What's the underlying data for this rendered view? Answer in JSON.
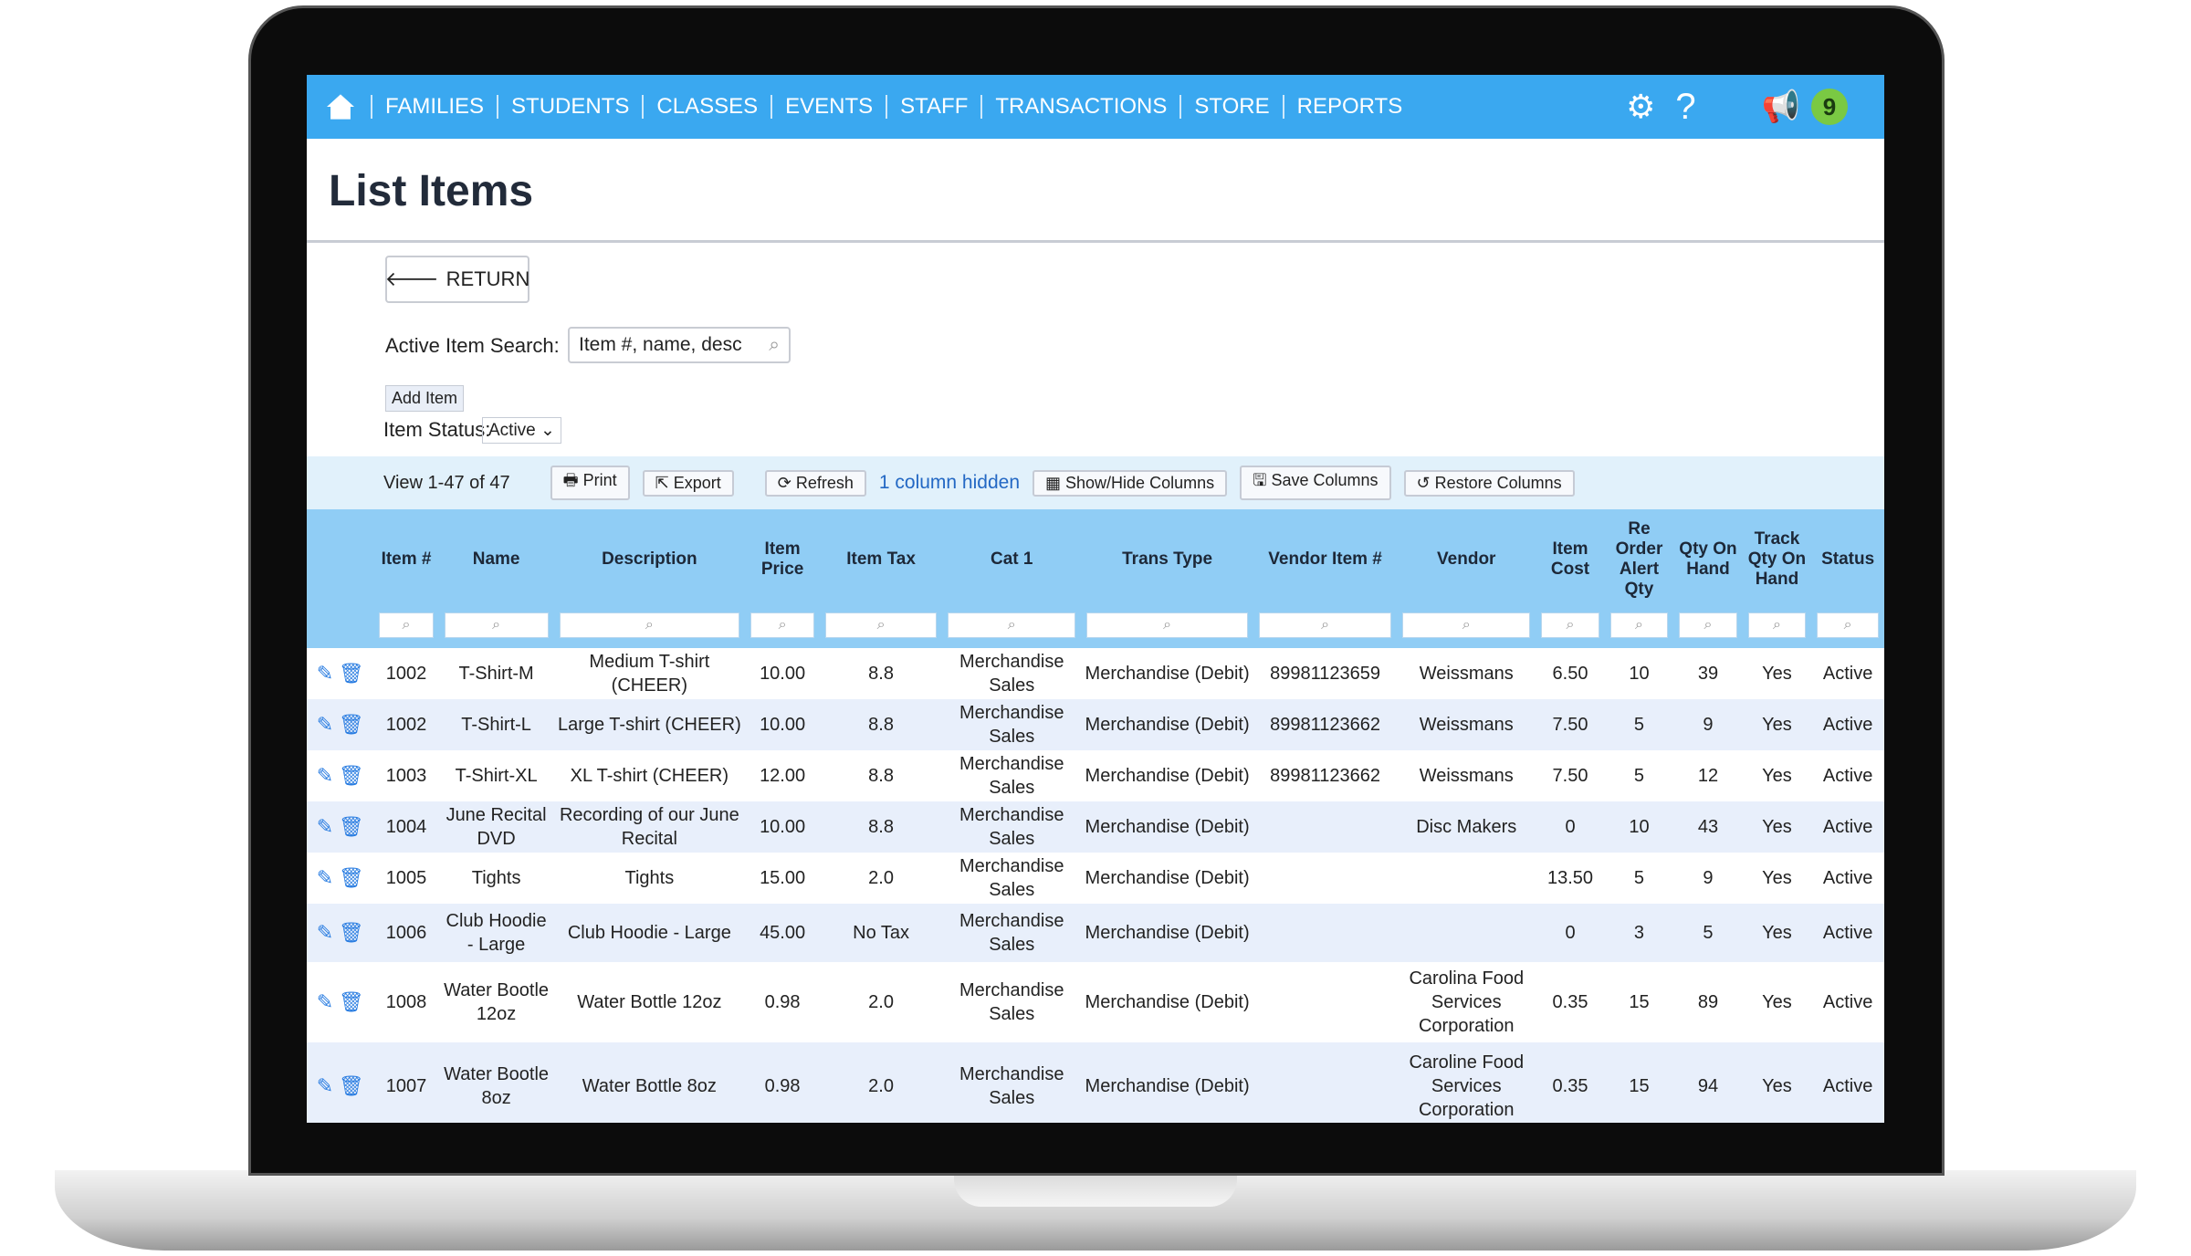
{
  "nav": {
    "items": [
      "FAMILIES",
      "STUDENTS",
      "CLASSES",
      "EVENTS",
      "STAFF",
      "TRANSACTIONS",
      "STORE",
      "REPORTS"
    ],
    "notifications": "9"
  },
  "page": {
    "title": "List Items",
    "return_label": "RETURN",
    "search_label": "Active Item Search:",
    "search_placeholder": "Item #, name, desc",
    "add_item": "Add Item",
    "status_label": "Item Status:",
    "status_value": "Active"
  },
  "toolbar": {
    "view": "View 1-47 of 47",
    "print": "Print",
    "export": "Export",
    "refresh": "Refresh",
    "hidden": "1 column hidden",
    "showhide": "Show/Hide Columns",
    "save": "Save Columns",
    "restore": "Restore Columns"
  },
  "columns": [
    "Item #",
    "Name",
    "Description",
    "Item Price",
    "Item Tax",
    "Cat 1",
    "Trans Type",
    "Vendor Item #",
    "Vendor",
    "Item Cost",
    "Re Order Alert Qty",
    "Qty On Hand",
    "Track Qty On Hand",
    "Status"
  ],
  "rows": [
    [
      "1002",
      "T-Shirt-M",
      "Medium T-shirt (CHEER)",
      "10.00",
      "8.8",
      "Merchandise Sales",
      "Merchandise (Debit)",
      "89981123659",
      "Weissmans",
      "6.50",
      "10",
      "39",
      "Yes",
      "Active"
    ],
    [
      "1002",
      "T-Shirt-L",
      "Large T-shirt (CHEER)",
      "10.00",
      "8.8",
      "Merchandise Sales",
      "Merchandise (Debit)",
      "89981123662",
      "Weissmans",
      "7.50",
      "5",
      "9",
      "Yes",
      "Active"
    ],
    [
      "1003",
      "T-Shirt-XL",
      "XL T-shirt (CHEER)",
      "12.00",
      "8.8",
      "Merchandise Sales",
      "Merchandise (Debit)",
      "89981123662",
      "Weissmans",
      "7.50",
      "5",
      "12",
      "Yes",
      "Active"
    ],
    [
      "1004",
      "June Recital DVD",
      "Recording of our June Recital",
      "10.00",
      "8.8",
      "Merchandise Sales",
      "Merchandise (Debit)",
      "",
      "Disc Makers",
      "0",
      "10",
      "43",
      "Yes",
      "Active"
    ],
    [
      "1005",
      "Tights",
      "Tights",
      "15.00",
      "2.0",
      "Merchandise Sales",
      "Merchandise (Debit)",
      "",
      "",
      "13.50",
      "5",
      "9",
      "Yes",
      "Active"
    ],
    [
      "1006",
      "Club Hoodie - Large",
      "Club Hoodie - Large",
      "45.00",
      "No Tax",
      "Merchandise Sales",
      "Merchandise (Debit)",
      "",
      "",
      "0",
      "3",
      "5",
      "Yes",
      "Active"
    ],
    [
      "1008",
      "Water Bootle 12oz",
      "Water Bottle 12oz",
      "0.98",
      "2.0",
      "Merchandise Sales",
      "Merchandise (Debit)",
      "",
      "Carolina Food Services Corporation",
      "0.35",
      "15",
      "89",
      "Yes",
      "Active"
    ],
    [
      "1007",
      "Water Bootle 8oz",
      "Water Bottle 8oz",
      "0.98",
      "2.0",
      "Merchandise Sales",
      "Merchandise (Debit)",
      "",
      "Caroline Food Services Corporation",
      "0.35",
      "15",
      "94",
      "Yes",
      "Active"
    ]
  ]
}
